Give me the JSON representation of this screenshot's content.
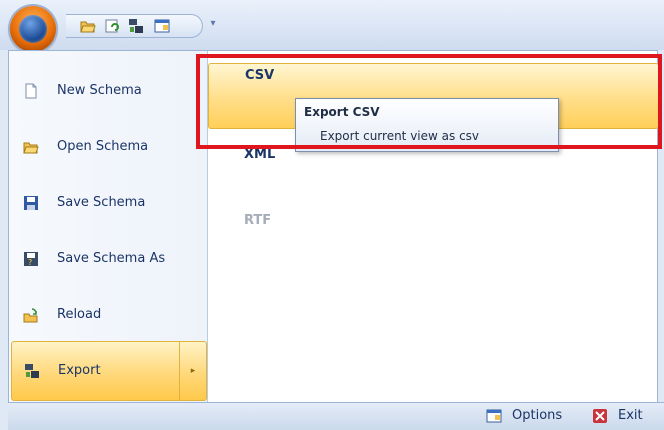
{
  "quick_access": {
    "icons": [
      "folder-open-icon",
      "save-refresh-icon",
      "export-icon",
      "window-icon"
    ],
    "customize_arrow": "▾"
  },
  "menu": {
    "items": [
      {
        "label": "New Schema",
        "icon": "new-document-icon"
      },
      {
        "label": "Open Schema",
        "icon": "folder-open-icon"
      },
      {
        "label": "Save Schema",
        "icon": "floppy-disk-icon"
      },
      {
        "label": "Save Schema As",
        "icon": "floppy-disk-as-icon"
      },
      {
        "label": "Reload",
        "icon": "reload-folder-icon"
      },
      {
        "label": "Export",
        "icon": "export-icon",
        "selected": true
      }
    ],
    "submenu_arrow": "▸"
  },
  "export_submenu": {
    "items": [
      {
        "label": "CSV",
        "state": "highlighted"
      },
      {
        "label": "XML",
        "state": "normal"
      },
      {
        "label": "RTF",
        "state": "disabled"
      }
    ]
  },
  "tooltip": {
    "title": "Export CSV",
    "body": "Export current view as csv"
  },
  "statusbar": {
    "options_label": "Options",
    "exit_label": "Exit"
  },
  "colors": {
    "highlight_border": "#e0b33d",
    "annotation_red": "#e0161e",
    "text": "#1b3567"
  }
}
